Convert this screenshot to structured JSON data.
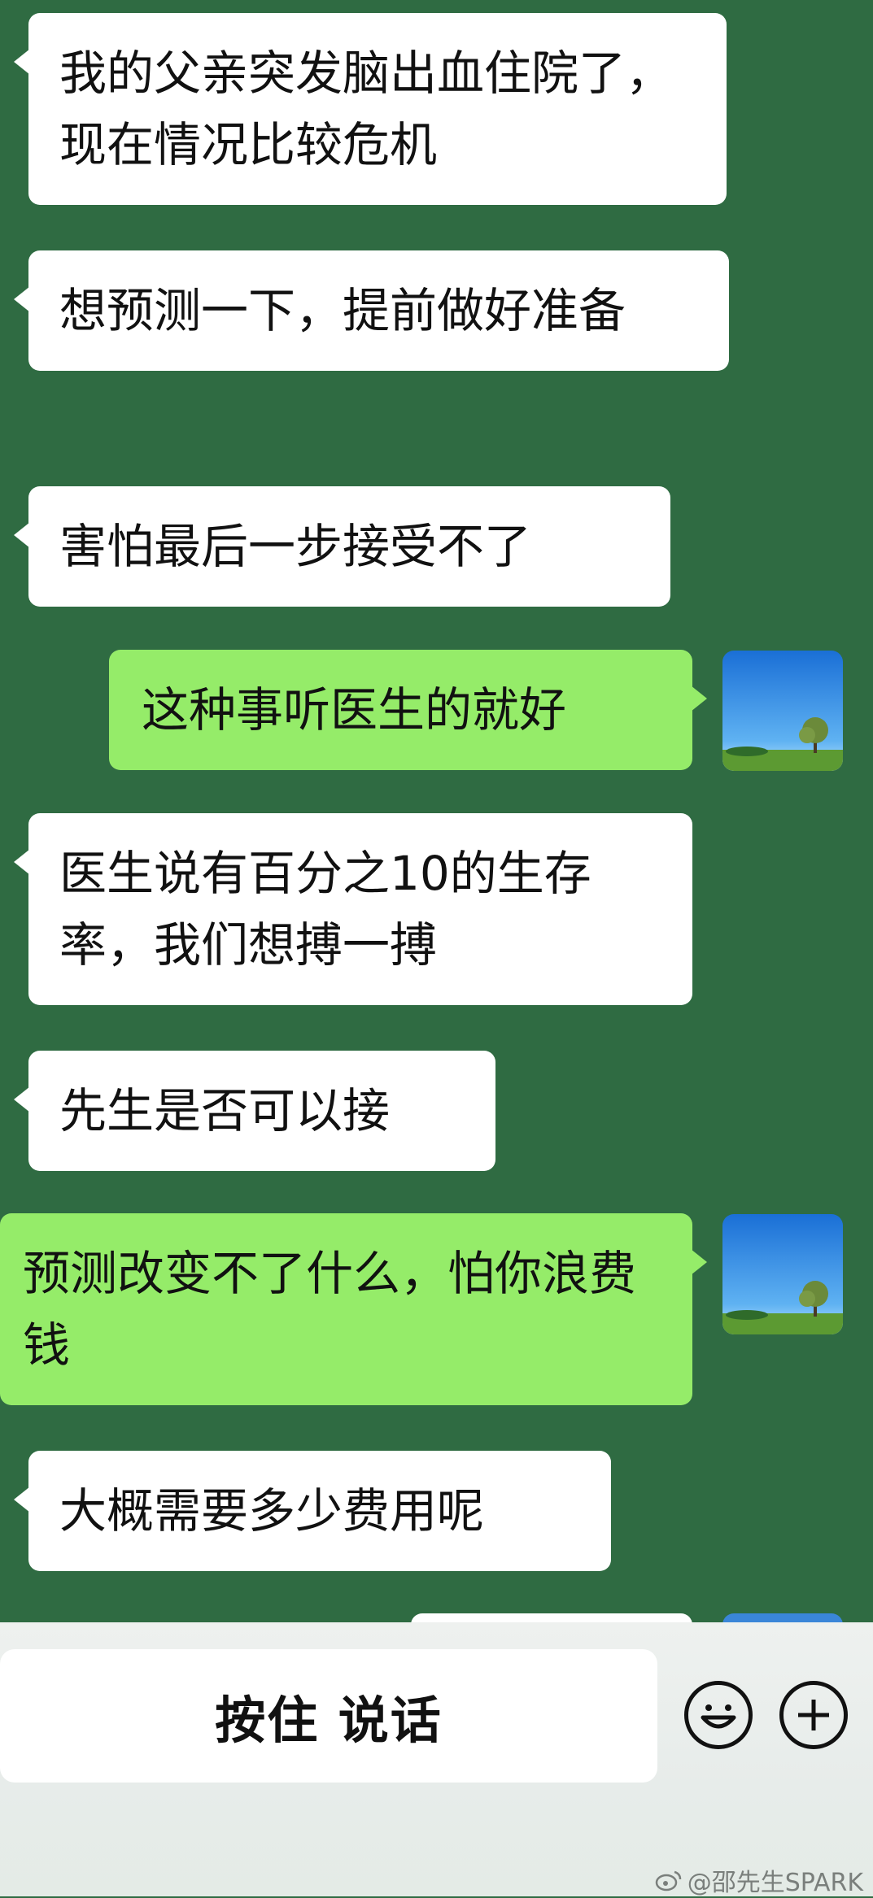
{
  "messages": [
    {
      "side": "left",
      "text": "我的父亲突发脑出血住院了，现在情况比较危机"
    },
    {
      "side": "left",
      "text": "想预测一下，提前做好准备"
    },
    {
      "side": "left",
      "text": "害怕最后一步接受不了"
    },
    {
      "side": "right",
      "text": "这种事听医生的就好"
    },
    {
      "side": "left",
      "text": "医生说有百分之10的生存率，我们想搏一搏"
    },
    {
      "side": "left",
      "text": "先生是否可以接"
    },
    {
      "side": "right",
      "text": "预测改变不了什么，怕你浪费钱"
    },
    {
      "side": "left",
      "text": "大概需要多少费用呢"
    }
  ],
  "input_bar": {
    "hold_to_talk_label": "按住 说话",
    "emoji_icon": "emoji-icon",
    "plus_icon": "plus-icon"
  },
  "watermark": "@邵先生SPARK",
  "colors": {
    "background": "#2f6b42",
    "left_bubble": "#ffffff",
    "right_bubble": "#95ec69"
  }
}
